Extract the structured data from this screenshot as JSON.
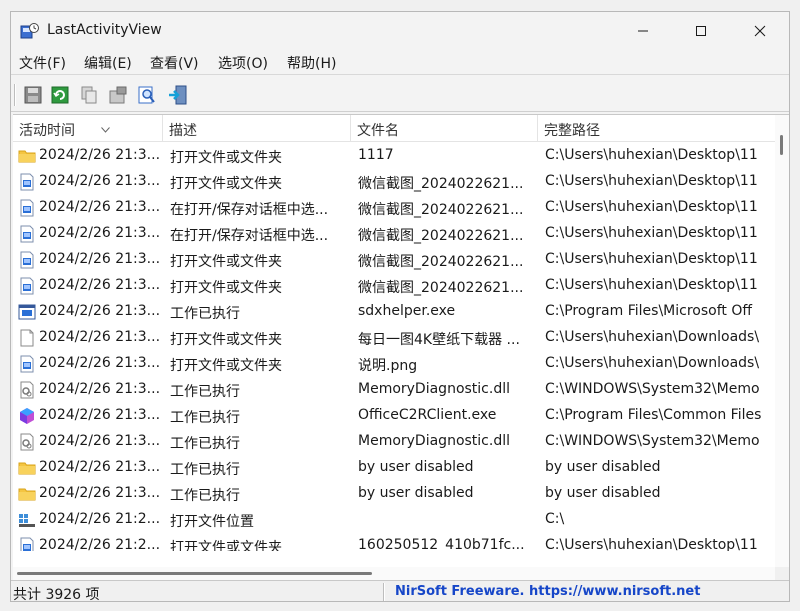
{
  "window": {
    "title": "LastActivityView"
  },
  "menu": [
    {
      "label": "文件(F)"
    },
    {
      "label": "编辑(E)"
    },
    {
      "label": "查看(V)"
    },
    {
      "label": "选项(O)"
    },
    {
      "label": "帮助(H)"
    }
  ],
  "toolbar": {
    "buttons": [
      {
        "name": "save-icon"
      },
      {
        "name": "refresh-icon"
      },
      {
        "name": "copy-icon"
      },
      {
        "name": "properties-icon"
      },
      {
        "name": "find-icon"
      },
      {
        "name": "exit-icon"
      }
    ]
  },
  "columns": [
    {
      "label": "活动时间"
    },
    {
      "label": "描述"
    },
    {
      "label": "文件名"
    },
    {
      "label": "完整路径"
    }
  ],
  "rows": [
    {
      "icon": "folder",
      "time": "2024/2/26 21:3...",
      "desc": "打开文件或文件夹",
      "file": "1117",
      "path": "C:\\Users\\huhexian\\Desktop\\11"
    },
    {
      "icon": "image",
      "time": "2024/2/26 21:3...",
      "desc": "打开文件或文件夹",
      "file": "微信截图_2024022621...",
      "path": "C:\\Users\\huhexian\\Desktop\\11"
    },
    {
      "icon": "image",
      "time": "2024/2/26 21:3...",
      "desc": "在打开/保存对话框中选...",
      "file": "微信截图_2024022621...",
      "path": "C:\\Users\\huhexian\\Desktop\\11"
    },
    {
      "icon": "image",
      "time": "2024/2/26 21:3...",
      "desc": "在打开/保存对话框中选...",
      "file": "微信截图_2024022621...",
      "path": "C:\\Users\\huhexian\\Desktop\\11"
    },
    {
      "icon": "image",
      "time": "2024/2/26 21:3...",
      "desc": "打开文件或文件夹",
      "file": "微信截图_2024022621...",
      "path": "C:\\Users\\huhexian\\Desktop\\11"
    },
    {
      "icon": "image",
      "time": "2024/2/26 21:3...",
      "desc": "打开文件或文件夹",
      "file": "微信截图_2024022621...",
      "path": "C:\\Users\\huhexian\\Desktop\\11"
    },
    {
      "icon": "exe",
      "time": "2024/2/26 21:3...",
      "desc": "工作已执行",
      "file": "sdxhelper.exe",
      "path": "C:\\Program Files\\Microsoft Off"
    },
    {
      "icon": "blank",
      "time": "2024/2/26 21:3...",
      "desc": "打开文件或文件夹",
      "file": "每日一图4K壁纸下载器 ...",
      "path": "C:\\Users\\huhexian\\Downloads\\"
    },
    {
      "icon": "image",
      "time": "2024/2/26 21:3...",
      "desc": "打开文件或文件夹",
      "file": "说明.png",
      "path": "C:\\Users\\huhexian\\Downloads\\"
    },
    {
      "icon": "dll",
      "time": "2024/2/26 21:3...",
      "desc": "工作已执行",
      "file": "MemoryDiagnostic.dll",
      "path": "C:\\WINDOWS\\System32\\Memo"
    },
    {
      "icon": "office",
      "time": "2024/2/26 21:3...",
      "desc": "工作已执行",
      "file": "OfficeC2RClient.exe",
      "path": "C:\\Program Files\\Common Files"
    },
    {
      "icon": "dll",
      "time": "2024/2/26 21:3...",
      "desc": "工作已执行",
      "file": "MemoryDiagnostic.dll",
      "path": "C:\\WINDOWS\\System32\\Memo"
    },
    {
      "icon": "folder",
      "time": "2024/2/26 21:3...",
      "desc": "工作已执行",
      "file": "by user disabled",
      "path": "by user disabled"
    },
    {
      "icon": "folder",
      "time": "2024/2/26 21:3...",
      "desc": "工作已执行",
      "file": "by user disabled",
      "path": "by user disabled"
    },
    {
      "icon": "drive",
      "time": "2024/2/26 21:2...",
      "desc": "打开文件位置",
      "file": "",
      "path": "C:\\"
    },
    {
      "icon": "image",
      "time": "2024/2/26 21:2...",
      "desc": "打开文件或文件夹",
      "file": "160250512_410b71fc...",
      "path": "C:\\Users\\huhexian\\Desktop\\11"
    }
  ],
  "status": {
    "count": "共计 3926 项",
    "link": "NirSoft Freeware. https://www.nirsoft.net"
  },
  "colors": {
    "link": "#1646c8",
    "folder": "#f4c542",
    "accent": "#2a6fd6"
  }
}
